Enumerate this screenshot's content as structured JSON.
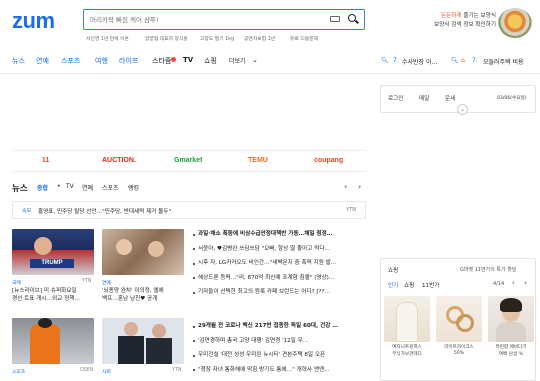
{
  "header": {
    "logo": "zum",
    "search": {
      "placeholder": "머리카락 빠짐 케어 샴푸!"
    },
    "keywords": [
      "서인영 1년 만에 이혼",
      "양궁협 대표차 장식칼",
      "고양도 딸기 1kg",
      "공연자보험 1년",
      "유로 디봉운해"
    ],
    "promo": {
      "line1_highlight": "든든하게",
      "line1_rest": "즐기는 보양식",
      "line2": "보양식 검색 정보 확인하기"
    }
  },
  "nav": {
    "items": [
      "뉴스",
      "연예",
      "스포츠",
      "여행",
      "라이프",
      "스타줌",
      "TV",
      "쇼핑",
      "더보기"
    ],
    "trends": [
      {
        "rank": "7.",
        "text": "수사반장 이…"
      },
      {
        "rank": "7.",
        "text": "모들러주택 비용"
      }
    ]
  },
  "sidebar": {
    "login": "로그인",
    "mail": "메일",
    "weather": "운세",
    "date": "03/06(수요일)"
  },
  "shopping_partners": [
    "11",
    "AUCTION.",
    "Gmarket",
    "TEMU",
    "coupang"
  ],
  "news": {
    "title": "뉴스",
    "tabs": [
      "종합",
      "TV",
      "연예",
      "스포츠",
      "랭킹"
    ],
    "ticker": {
      "tag": "속보",
      "text": "홍영표, 민주당 탈당 선언…\"민주당, 반대세력 제거 몰두\"",
      "source": "YTN"
    },
    "cards": [
      {
        "tag": "국제",
        "src": "YTN",
        "lines": [
          "[뉴스라이브] 미 슈퍼화요일",
          "경선 트표 개시…외교 정책…"
        ]
      },
      {
        "tag": "연예",
        "src": "",
        "lines": [
          "'뇌종양 완치' 이의정, 엘에",
          "백프…훈남 남친♥ 공개"
        ]
      },
      {
        "tag": "스포츠",
        "src": "OSEN",
        "lines": [
          ""
        ]
      },
      {
        "tag": "사회",
        "src": "YTN",
        "lines": [
          ""
        ]
      }
    ],
    "headlines_top": [
      "과일·채소 폭등에 비상수급안정대책반 가동…채일 청정…",
      "서윤아, ♥김병완 쓰담쓰담 \"오빠, 항상 딸 좋아고 먹다…",
      "시후 자, LG카카오도 비인간…\"새벽몬지 중 폭력 지원 발…",
      "해상드론 등력…\"러, 870억 최신예 조계함 침몰\" (영상)…",
      "기자들이 선택한 최고의 원룩 카페 브런드는 어디? [??…"
    ],
    "headlines_bottom": [
      "29개월 전 코로나 백신 217번 접종한 독일 60대, 건강 …",
      "'김연경하며 총국 고양 대행' 김연경 '12일 우…",
      "우미건설 '대전 성성 우미린 뉴시티' 견본주택 8일 오픈",
      "\"청장 자녀 통화해에 막힘 방기도 통에…\" 개혁사 앤엔…"
    ]
  },
  "shop_widget": {
    "title": "쇼핑",
    "promo": "G마켓 11번가의 특가 핫딜",
    "tabs": [
      "인기",
      "쇼핑",
      "11번가"
    ],
    "page": "4/14",
    "products": [
      {
        "name": "여자니트원피스",
        "price": "무늬가보관데디"
      },
      {
        "name": "라이트하이크스",
        "price": "50%"
      },
      {
        "name": "목련향 에바다기",
        "price": "여배 남섬 %"
      }
    ]
  }
}
